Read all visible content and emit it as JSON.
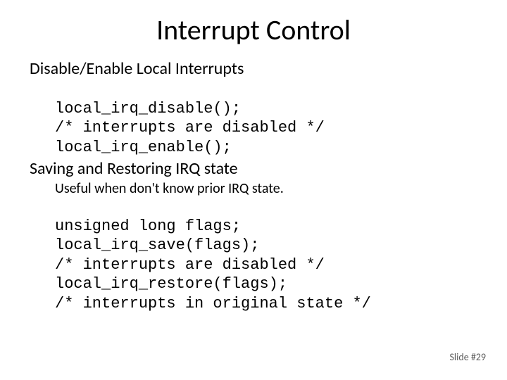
{
  "title": "Interrupt Control",
  "section1": {
    "heading": "Disable/Enable Local Interrupts",
    "code": [
      "local_irq_disable();",
      "/* interrupts are disabled */",
      "local_irq_enable();"
    ]
  },
  "section2": {
    "heading": "Saving and Restoring IRQ state",
    "note": "Useful when don't know prior IRQ state.",
    "code": [
      "unsigned long flags;",
      "local_irq_save(flags);",
      "/* interrupts are disabled */",
      "local_irq_restore(flags);",
      "/* interrupts in original state */"
    ]
  },
  "footer": "Slide #29"
}
